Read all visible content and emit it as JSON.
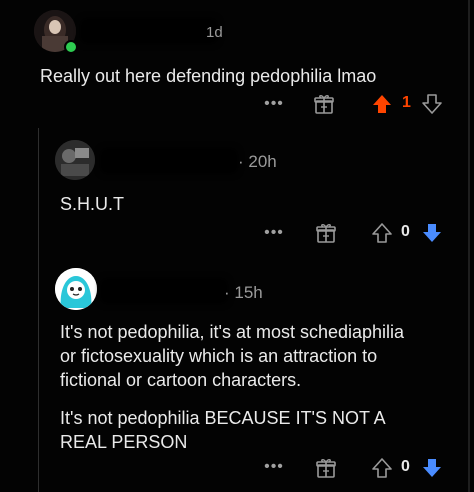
{
  "colors": {
    "upvote_active": "#ff4500",
    "downvote_active": "#4a8cff",
    "text": "#eaeaea",
    "muted": "#9a9a9a",
    "online": "#2ecc51"
  },
  "comments": [
    {
      "author": "redacted",
      "timestamp_fragment": "1d",
      "body_lines": [
        "Really out here defending pedophilia lmao"
      ],
      "vote_count": "1",
      "vote_state": "upvoted"
    },
    {
      "author": "redacted",
      "timestamp": "20h",
      "body_lines": [
        "S.H.U.T"
      ],
      "vote_count": "0",
      "vote_state": "downvoted"
    },
    {
      "author": "redacted",
      "timestamp": "15h",
      "body_lines": [
        "It's not pedophilia, it's at most schediaphilia",
        "or fictosexuality which is an attraction to",
        "fictional or cartoon characters."
      ],
      "body_lines_2": [
        "It's not pedophilia BECAUSE IT'S NOT A",
        "REAL PERSON"
      ],
      "vote_count": "0",
      "vote_state": "downvoted"
    }
  ],
  "icons": {
    "more": "more-options-icon",
    "award": "award-gift-icon",
    "upvote": "upvote-arrow-icon",
    "downvote": "downvote-arrow-icon"
  },
  "more_glyph": "•••"
}
